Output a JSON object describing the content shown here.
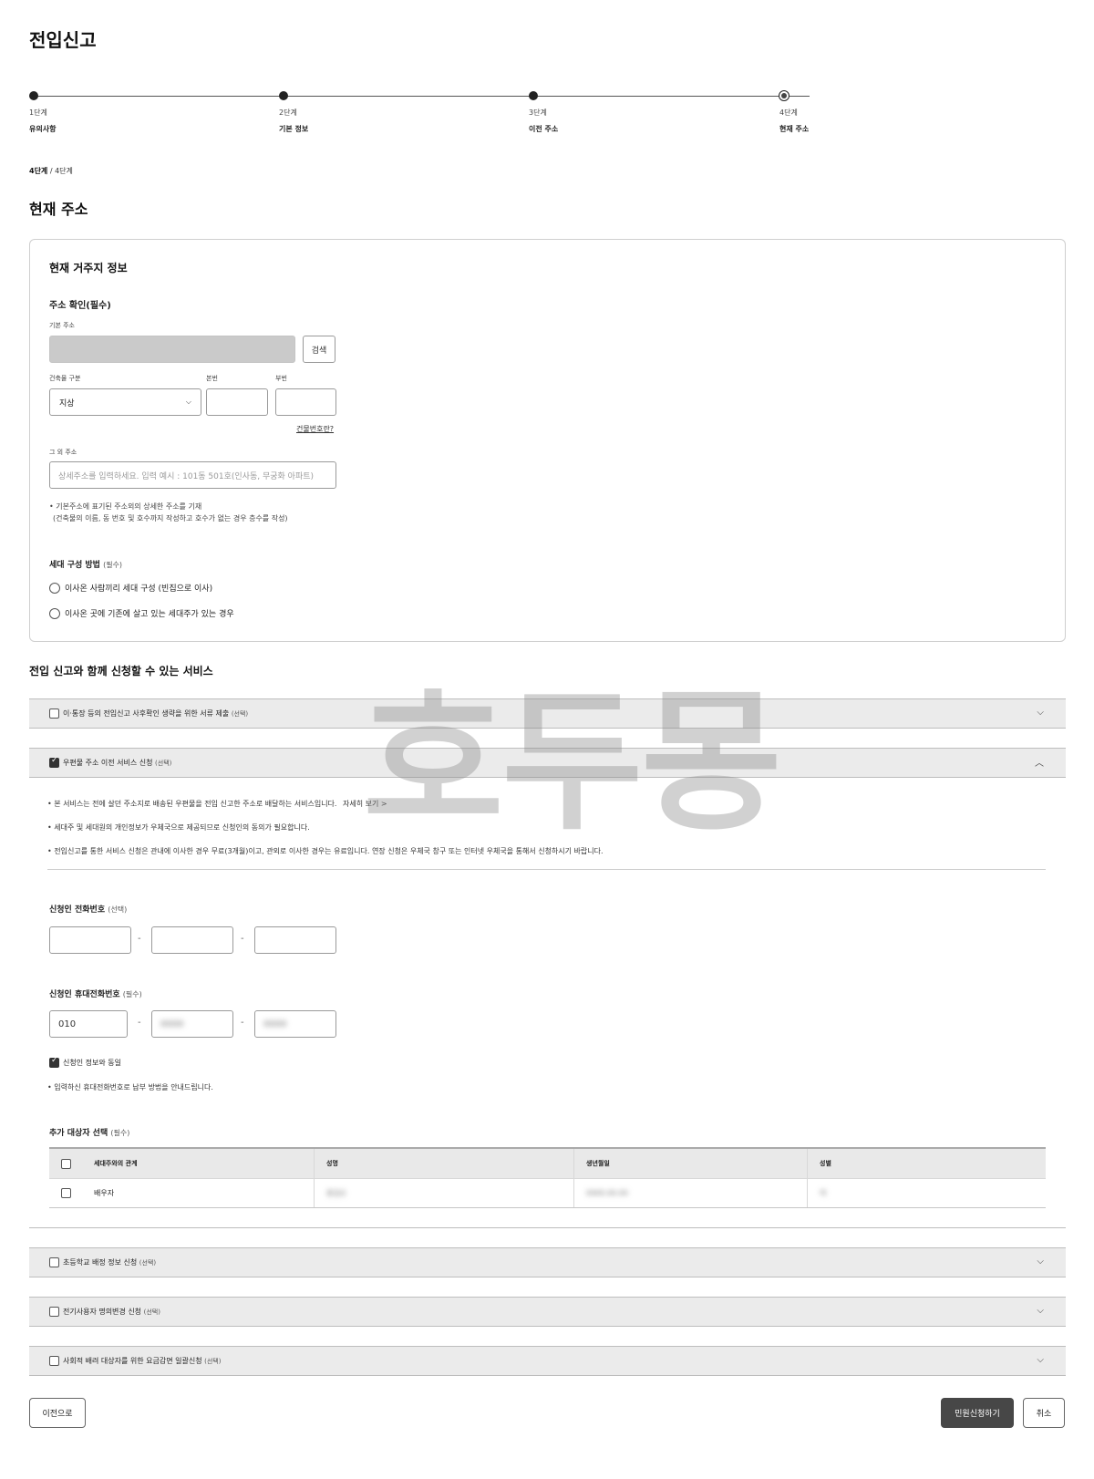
{
  "page": {
    "title": "전입신고"
  },
  "stepper": {
    "steps": [
      {
        "num": "1단계",
        "name": "유의사항"
      },
      {
        "num": "2단계",
        "name": "기본 정보"
      },
      {
        "num": "3단계",
        "name": "이전 주소"
      },
      {
        "num": "4단계",
        "name": "현재 주소"
      }
    ],
    "current_index": 3
  },
  "progress": {
    "current": "4단계",
    "separator": "/",
    "total": "4단계"
  },
  "section": {
    "title": "현재 주소"
  },
  "residence": {
    "title": "현재 거주지 정보",
    "address_heading": "주소 확인(필수)",
    "basic_address_label": "기본 주소",
    "basic_address_value": "",
    "search_label": "검색",
    "building_type_label": "건축물 구분",
    "building_type_value": "지상",
    "main_num_label": "본번",
    "sub_num_label": "부번",
    "building_num_link": "건물번호란?",
    "other_address_label": "그 외 주소",
    "other_address_placeholder": "상세주소를 입력하세요. 입력 예시 : 101동 501호(인사동, 무궁화 아파트)",
    "note_line1": "• 기본주소에 표기된 주소외의 상세한 주소를 기재",
    "note_line2": "(건축물의 이름, 동 번호 및 호수까지 작성하고 호수가 없는 경우 층수를 작성)",
    "household_heading": "세대 구성 방법",
    "household_req": "(필수)",
    "household_options": [
      "이사온 사람끼리 세대 구성 (빈집으로 이사)",
      "이사온 곳에 기존에 살고 있는 세대주가 있는 경우"
    ]
  },
  "services": {
    "title": "전입 신고와 함께 신청할 수 있는 서비스",
    "optional": "(선택)",
    "items": [
      {
        "label": "이·통장 등의 전입신고 사후확인 생략을 위한 서류 제출",
        "checked": false
      },
      {
        "label": "우편물 주소 이전 서비스 신청",
        "checked": true
      },
      {
        "label": "초등학교 배정 정보 신청",
        "checked": false
      },
      {
        "label": "전기사용자 명의변경 신청",
        "checked": false
      },
      {
        "label": "사회적 배려 대상자를 위한 요금감면 일괄신청",
        "checked": false
      }
    ]
  },
  "mail": {
    "bullet1": "• 본 서비스는 전에 살던 주소지로 배송된 우편물을 전입 신고한 주소로 배달하는 서비스입니다.",
    "more_link": "자세히 보기 >",
    "bullet2": "• 세대주 및 세대원의 개인정보가 우체국으로 제공되므로 신청인의 동의가 필요합니다.",
    "bullet3": "• 전입신고를 통한 서비스 신청은 관내에 이사한 경우 무료(3개월)이고, 관외로 이사한 경우는 유료입니다. 연장 신청은 우체국 창구 또는 인터넷 우체국을 통해서 신청하시기 바랍니다.",
    "phone_heading": "신청인 전화번호",
    "phone_req": "(선택)",
    "mobile_heading": "신청인 휴대전화번호",
    "mobile_req": "(필수)",
    "mobile_prefix": "010",
    "mobile_mid": "0000",
    "mobile_last": "0000",
    "dash": "-",
    "same_as_applicant": "신청인 정보와 동일",
    "payment_note": "• 입력하신 휴대전화번호로 납부 방법을 안내드립니다.",
    "target_heading": "추가 대상자 선택",
    "target_req": "(필수)",
    "table": {
      "headers": [
        "세대주와의 관계",
        "성명",
        "생년월일",
        "성별"
      ],
      "rows": [
        {
          "relation": "배우자",
          "name": "홍길순",
          "birth": "0000.00.00",
          "gender": "여"
        }
      ]
    }
  },
  "buttons": {
    "prev": "이전으로",
    "submit": "민원신청하기",
    "cancel": "취소"
  },
  "watermark": "호두몽"
}
